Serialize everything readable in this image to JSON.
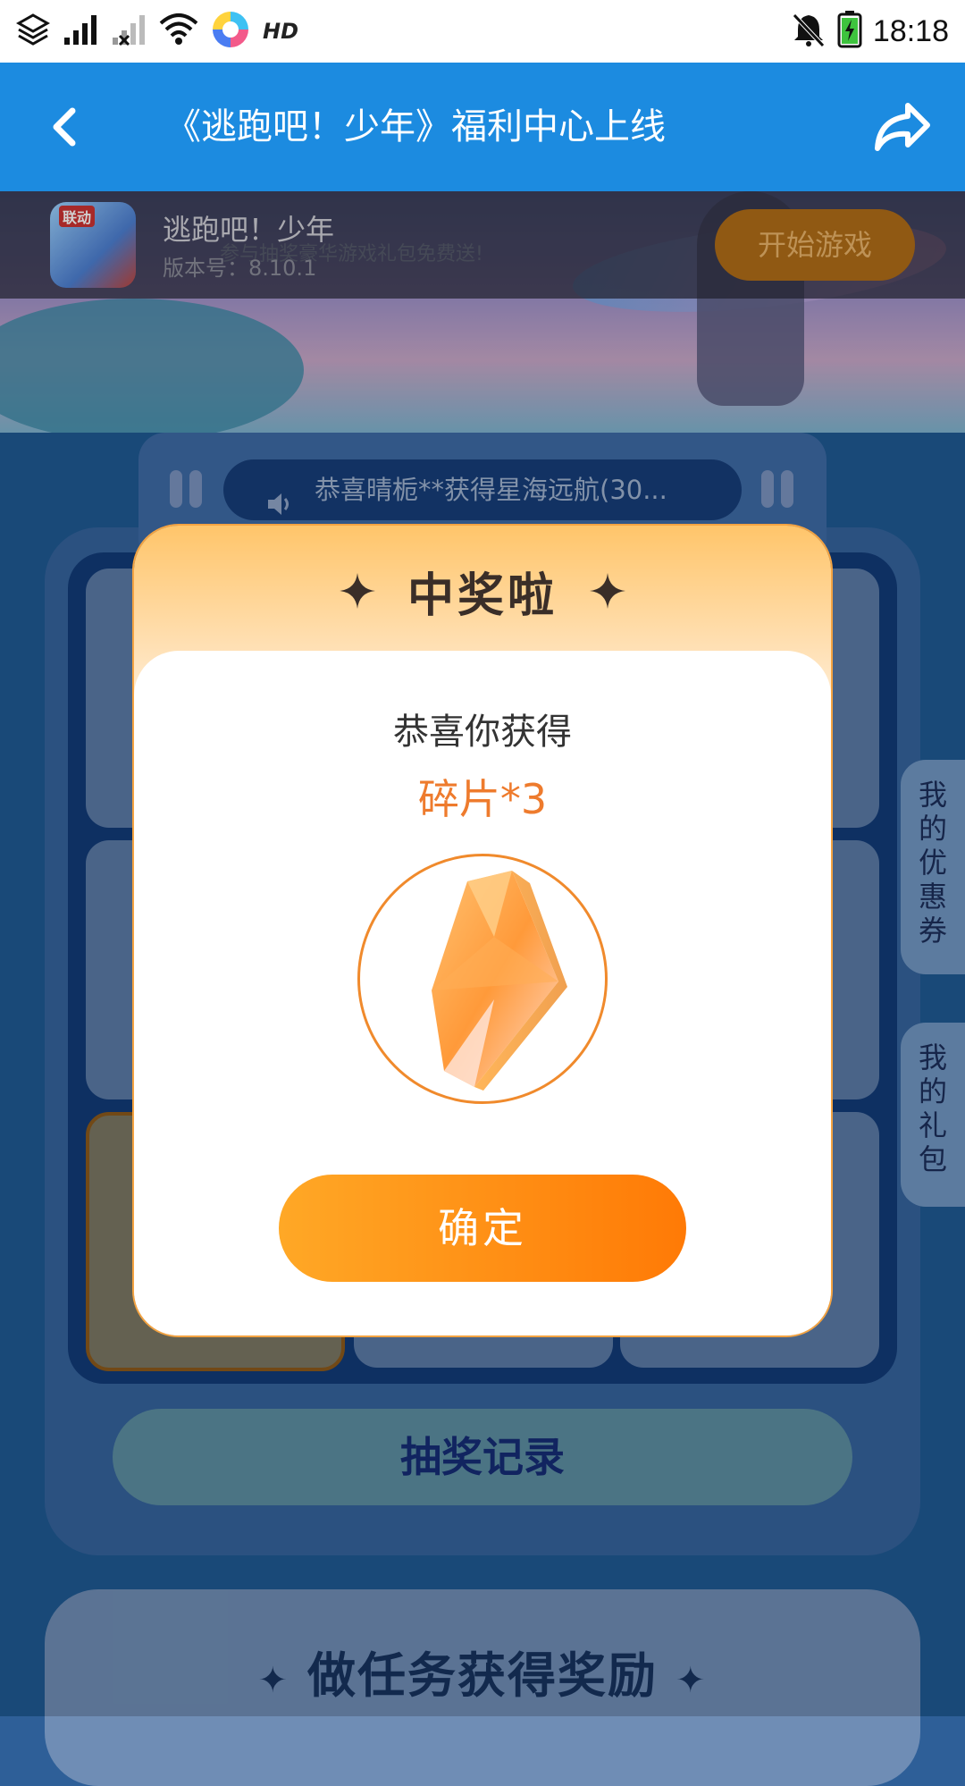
{
  "status_bar": {
    "time": "18:18",
    "hd": "HD"
  },
  "appbar": {
    "title": "《逃跑吧！少年》福利中心上线"
  },
  "game": {
    "name": "逃跑吧！少年",
    "icon_tag": "联动",
    "subtitle": "参与抽奖豪华游戏礼包免费送!",
    "version": "版本号：8.10.1",
    "start_label": "开始游戏"
  },
  "ticker": {
    "text": "恭喜晴栀**获得星海远航(30..."
  },
  "records": {
    "label": "抽奖记录"
  },
  "tasks": {
    "title": "做任务获得奖励"
  },
  "side_tabs": {
    "coupon": [
      "我",
      "的",
      "优",
      "惠",
      "券"
    ],
    "gift": [
      "我",
      "的",
      "礼",
      "包"
    ]
  },
  "modal": {
    "title": "中奖啦",
    "congrats": "恭喜你获得",
    "prize": "碎片*3",
    "confirm": "确定"
  },
  "colors": {
    "appbar": "#1c8be0",
    "accent_orange": "#ff8c12",
    "prize_text": "#ee7b2d"
  }
}
